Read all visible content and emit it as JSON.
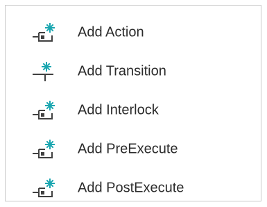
{
  "menu": {
    "items": [
      {
        "label": "Add Action",
        "icon": "add-action-icon"
      },
      {
        "label": "Add Transition",
        "icon": "add-transition-icon"
      },
      {
        "label": "Add Interlock",
        "icon": "add-interlock-icon"
      },
      {
        "label": "Add PreExecute",
        "icon": "add-preexecute-icon"
      },
      {
        "label": "Add PostExecute",
        "icon": "add-postexecute-icon"
      }
    ]
  },
  "colors": {
    "icon_dark": "#404040",
    "icon_accent": "#1aa6b0",
    "border": "#c8c8c8",
    "text": "#2b2b2b"
  }
}
